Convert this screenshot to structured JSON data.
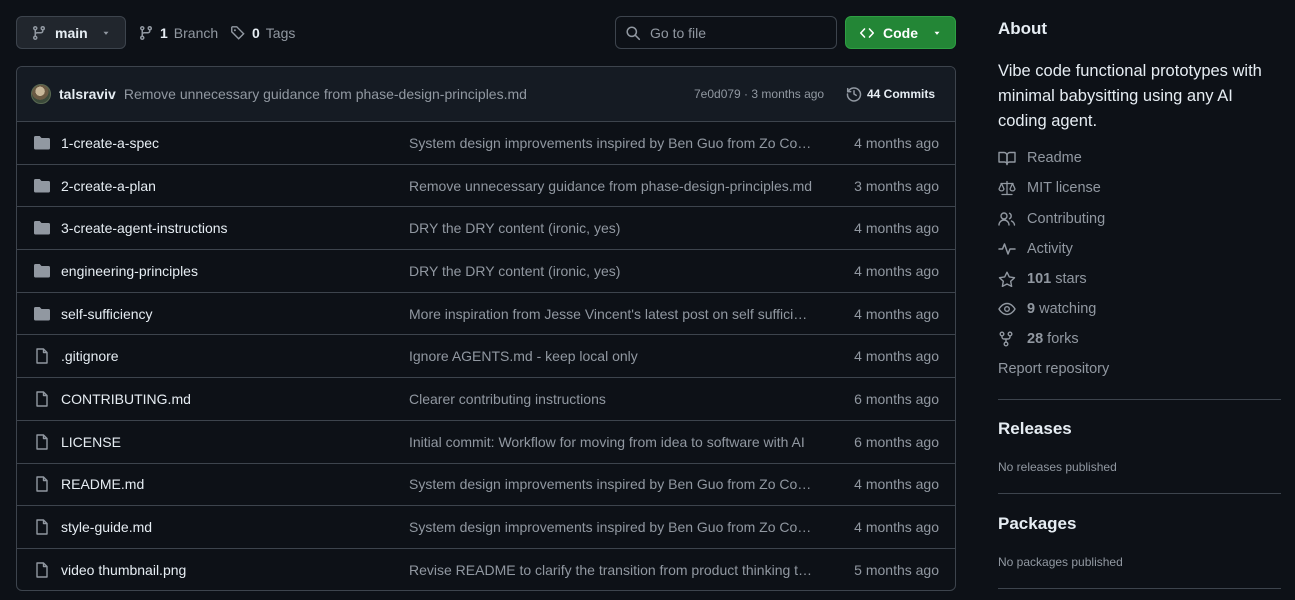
{
  "toolbar": {
    "branch": "main",
    "branch_count": "1",
    "branch_label": "Branch",
    "tag_count": "0",
    "tag_label": "Tags",
    "goto_placeholder": "Go to file",
    "code_label": "Code"
  },
  "latest_commit": {
    "author": "talsraviv",
    "message": "Remove unnecessary guidance from phase-design-principles.md",
    "hash": "7e0d079",
    "separator": " · ",
    "age": "3 months ago",
    "commits_count": "44 Commits"
  },
  "files": [
    {
      "type": "folder",
      "name": "1-create-a-spec",
      "message": "System design improvements inspired by Ben Guo from Zo Computer",
      "date": "4 months ago"
    },
    {
      "type": "folder",
      "name": "2-create-a-plan",
      "message": "Remove unnecessary guidance from phase-design-principles.md",
      "date": "3 months ago"
    },
    {
      "type": "folder",
      "name": "3-create-agent-instructions",
      "message": "DRY the DRY content (ironic, yes)",
      "date": "4 months ago"
    },
    {
      "type": "folder",
      "name": "engineering-principles",
      "message": "DRY the DRY content (ironic, yes)",
      "date": "4 months ago"
    },
    {
      "type": "folder",
      "name": "self-sufficiency",
      "message": "More inspiration from Jesse Vincent's latest post on self sufficiency",
      "date": "4 months ago"
    },
    {
      "type": "file",
      "name": ".gitignore",
      "message": "Ignore AGENTS.md - keep local only",
      "date": "4 months ago"
    },
    {
      "type": "file",
      "name": "CONTRIBUTING.md",
      "message": "Clearer contributing instructions",
      "date": "6 months ago"
    },
    {
      "type": "file",
      "name": "LICENSE",
      "message": "Initial commit: Workflow for moving from idea to software with AI",
      "date": "6 months ago"
    },
    {
      "type": "file",
      "name": "README.md",
      "message": "System design improvements inspired by Ben Guo from Zo Computer",
      "date": "4 months ago"
    },
    {
      "type": "file",
      "name": "style-guide.md",
      "message": "System design improvements inspired by Ben Guo from Zo Computer",
      "date": "4 months ago"
    },
    {
      "type": "file",
      "name": "video thumbnail.png",
      "message": "Revise README to clarify the transition from product thinking to code",
      "date": "5 months ago"
    }
  ],
  "about": {
    "title": "About",
    "description": "Vibe code functional prototypes with minimal babysitting using any AI coding agent.",
    "links": {
      "readme": "Readme",
      "license": "MIT license",
      "contributing": "Contributing",
      "activity": "Activity",
      "stars_count": "101",
      "stars_label": "stars",
      "watching_count": "9",
      "watching_label": "watching",
      "forks_count": "28",
      "forks_label": "forks",
      "report": "Report repository"
    }
  },
  "releases": {
    "title": "Releases",
    "note": "No releases published"
  },
  "packages": {
    "title": "Packages",
    "note": "No packages published"
  },
  "colors": {
    "background": "#0d1117",
    "border": "#3d444d",
    "muted_text": "#9198a1",
    "code_button": "#238636"
  },
  "icons": {
    "branch": "git-branch-icon",
    "tag": "tag-icon",
    "search": "search-icon",
    "code": "code-icon",
    "history": "history-icon",
    "folder": "folder-icon",
    "file": "file-icon",
    "book": "book-icon",
    "law": "law-icon",
    "people": "people-icon",
    "pulse": "pulse-icon",
    "star": "star-icon",
    "eye": "eye-icon",
    "fork": "repo-forked-icon"
  }
}
